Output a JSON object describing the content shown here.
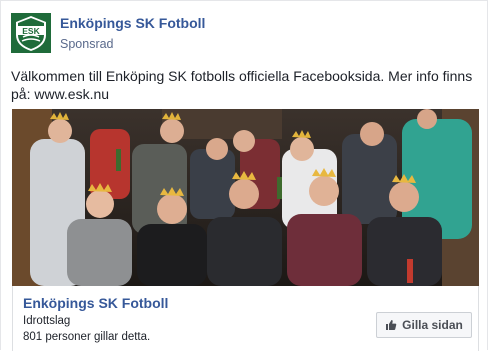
{
  "post": {
    "page_name": "Enköpings SK Fotboll",
    "sponsored_label": "Sponsrad",
    "avatar_text": "ESK",
    "text": "Välkommen till Enköping SK fotbolls officiella Facebooksida. Mer info finns på: www.esk.nu"
  },
  "footer": {
    "page_name": "Enköpings SK Fotboll",
    "category": "Idrottslag",
    "likes_text": "801 personer gillar detta.",
    "like_button_label": "Gilla sidan",
    "like_icon": "thumbs-up-icon"
  },
  "colors": {
    "link_blue": "#365899",
    "brand_green": "#1f6b3a",
    "button_bg": "#f6f7f9"
  }
}
